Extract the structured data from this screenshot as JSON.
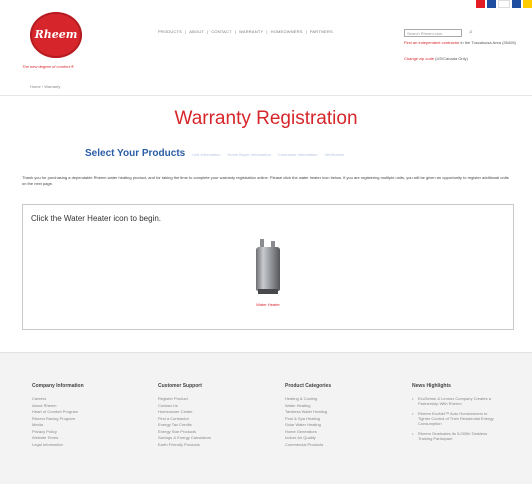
{
  "header": {
    "logo_text": "Rheem",
    "tagline": "The new degree of comfort.®",
    "nav": [
      "PRODUCTS",
      "ABOUT",
      "CONTACT",
      "WARRANTY",
      "HOMEOWNERS",
      "PARTNERS"
    ],
    "nav_separator": "|",
    "search_placeholder": "Search Rheem.com",
    "search_button": "⌕",
    "contractor_link": "Find an independent contractor",
    "contractor_area": "in the Tuscaloosa Area (35405)",
    "zip_link": "Change zip code",
    "zip_note": "(US/Canada Only)",
    "flag_colors": [
      "#e31b23",
      "#ffffff",
      "#1f4da0",
      "#e31b23",
      "#1f4da0",
      "#ffcc00"
    ]
  },
  "breadcrumb": {
    "home": "Home",
    "separator": "›",
    "current": "Warranty"
  },
  "page_title": "Warranty Registration",
  "steps": {
    "active": "Select Your Products",
    "others": [
      "Unit Information",
      "Home Buyer Information",
      "Contractor Information",
      "Verification"
    ]
  },
  "intro_text": "Thank you for purchasing a dependable Rheem water heating product, and for taking the time to complete your warranty registration online. Please click the water heater icon below. If you are registering multiple units, you will be given an opportunity to register additional units on the next page.",
  "panel": {
    "title": "Click the Water Heater icon to begin.",
    "product_label": "Water Heater"
  },
  "footer": {
    "company": {
      "title": "Company Information",
      "items": [
        "Careers",
        "About Rheem",
        "Heart of Comfort Program",
        "Rheem Racing Program",
        "Media",
        "Privacy Policy",
        "Website Terms",
        "Legal Information"
      ]
    },
    "support": {
      "title": "Customer Support",
      "items": [
        "Register Product",
        "Contact Us",
        "Homeowner Center",
        "Find a Contractor",
        "Energy Tax Credits",
        "Energy Star Products",
        "Savings & Energy Calculators",
        "Earth Friendly Products"
      ]
    },
    "categories": {
      "title": "Product Categories",
      "items": [
        "Heating & Cooling",
        "Water Heating",
        "Tankless Water Heating",
        "Pool & Spa Heating",
        "Solar Water Heating",
        "Home Generators",
        "Indoor Air Quality",
        "Commercial Products"
      ]
    },
    "news": {
      "title": "News Highlights",
      "items": [
        "EcoSense & Lennox Company Creates a Partnership With Rheem",
        "Rheem EcoNet™ Auto Homeowners to Tighter Control of Their Residential Energy Consumption",
        "Rheem Graduates Its 5,000th Tankless Training Participant"
      ]
    }
  }
}
